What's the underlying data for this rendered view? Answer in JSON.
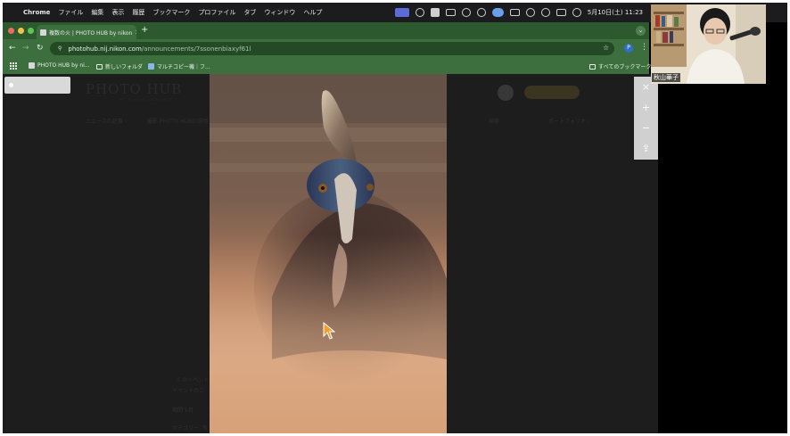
{
  "menubar": {
    "app": "Chrome",
    "items": [
      "ファイル",
      "編集",
      "表示",
      "履歴",
      "ブックマーク",
      "プロファイル",
      "タブ",
      "ウィンドウ",
      "ヘルプ"
    ],
    "clock": "5月10日(土) 11:23",
    "status_icons": [
      "screen-mirror-icon",
      "cloud-icon",
      "drive-icon",
      "window-icon",
      "mixer-icon",
      "app-icon",
      "display-icon",
      "battery-icon",
      "search-icon",
      "wifi-icon",
      "control-center-icon",
      "siri-icon"
    ]
  },
  "browser": {
    "tab_title": "複数の火 | PHOTO HUB by nikon",
    "new_tab": "+",
    "url_host": "photohub.nij.nikon.com",
    "url_path": "/announcements/7ssonenbiaxyf61l",
    "profile_initial": "P",
    "bookmarks": [
      "PHOTO HUB by ni...",
      "新しいフォルダ",
      "マルチコピー機｜フ...",
      "すべてのブックマーク"
    ]
  },
  "background_page": {
    "logo": "PHOTO HUB",
    "logo_sub": "BY NIKON IMAGING",
    "nav": [
      "ニュースの記事 ›",
      "撮影 PHOTO HUBの説明 ›",
      "検索",
      "ポートフォリオ ›"
    ],
    "text_line_1": "くのイベント",
    "text_line_2": "イベントのご",
    "text_line_3": "期間 5月",
    "text_line_4": "カテゴリー: 写"
  },
  "lightbox": {
    "close_label": "×",
    "zoom_in_label": "+",
    "zoom_out_label": "−",
    "share_label": "⇪"
  },
  "webcam": {
    "name": "秋山華子"
  },
  "colors": {
    "chrome_green": "#2c5a2e",
    "chrome_tab": "#3c6e3e",
    "page_dim": "#1d1d1d",
    "cursor": "#f0a030"
  }
}
